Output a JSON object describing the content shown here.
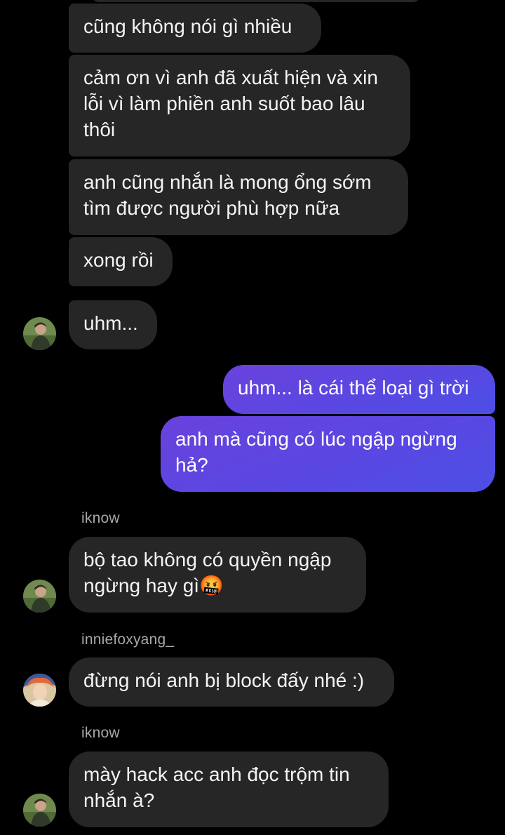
{
  "colors": {
    "background": "#000000",
    "received_bubble": "#262626",
    "sent_bubble_start": "#6a42dc",
    "sent_bubble_end": "#4c4fe6",
    "username_text": "#a8a8a8"
  },
  "messages": [
    {
      "id": "m1",
      "direction": "received",
      "sender": "iknow",
      "text": "cũng không nói gì nhiều"
    },
    {
      "id": "m2",
      "direction": "received",
      "sender": "iknow",
      "text": "cảm ơn vì anh đã xuất hiện và xin lỗi vì làm phiền anh suốt bao lâu thôi"
    },
    {
      "id": "m3",
      "direction": "received",
      "sender": "iknow",
      "text": "anh cũng nhắn là mong ổng sớm tìm được người phù hợp nữa"
    },
    {
      "id": "m4",
      "direction": "received",
      "sender": "iknow",
      "text": "xong rồi"
    },
    {
      "id": "m5",
      "direction": "received",
      "sender": "iknow",
      "text": "uhm..."
    },
    {
      "id": "m6",
      "direction": "sent",
      "text": "uhm... là cái thể loại gì trời"
    },
    {
      "id": "m7",
      "direction": "sent",
      "text": "anh mà cũng có lúc ngập ngừng hả?"
    },
    {
      "id": "m8",
      "direction": "received",
      "sender": "iknow",
      "show_username": true,
      "text": "bộ tao không có quyền ngập ngừng hay gì🤬"
    },
    {
      "id": "m9",
      "direction": "received",
      "sender": "inniefoxyang_",
      "show_username": true,
      "text": "đừng nói anh bị block đấy nhé :)"
    },
    {
      "id": "m10",
      "direction": "received",
      "sender": "iknow",
      "show_username": true,
      "text": "mày hack acc anh đọc trộm tin nhắn à?"
    }
  ],
  "usernames": {
    "u1": "iknow",
    "u2": "inniefoxyang_",
    "u3": "iknow"
  },
  "avatars": {
    "iknow": "profile-photo-green-field",
    "inniefoxyang_": "profile-photo-colorful-hair"
  }
}
